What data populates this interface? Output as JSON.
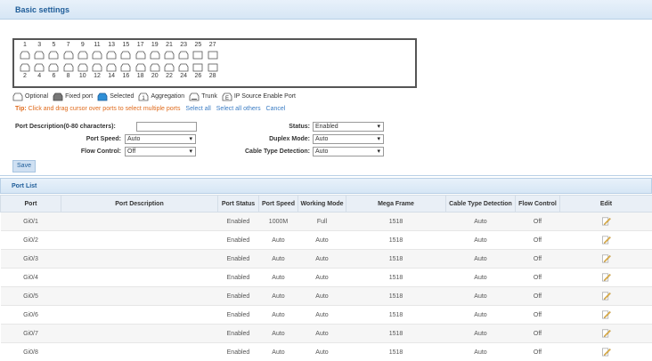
{
  "title": "Basic settings",
  "ports_top": [
    "1",
    "3",
    "5",
    "7",
    "9",
    "11",
    "13",
    "15",
    "17",
    "19",
    "21",
    "23",
    "25",
    "27"
  ],
  "ports_bottom": [
    "2",
    "4",
    "6",
    "8",
    "10",
    "12",
    "14",
    "16",
    "18",
    "20",
    "22",
    "24",
    "26",
    "28"
  ],
  "legend": {
    "optional": "Optional",
    "fixed": "Fixed port",
    "selected": "Selected",
    "aggregation": "Aggregation",
    "trunk": "Trunk",
    "ipsource": "IP Source Enable Port"
  },
  "tip": {
    "label": "Tip:",
    "text": "Click and drag cursor over ports to select multiple ports",
    "select_all": "Select all",
    "select_others": "Select all others",
    "cancel": "Cancel"
  },
  "form": {
    "desc_label": "Port Description(0-80 characters):",
    "desc_value": "",
    "status_label": "Status:",
    "status_value": "Enabled",
    "speed_label": "Port Speed:",
    "speed_value": "Auto",
    "duplex_label": "Duplex Mode:",
    "duplex_value": "Auto",
    "flow_label": "Flow Control:",
    "flow_value": "Off",
    "cable_label": "Cable Type Detection:",
    "cable_value": "Auto"
  },
  "save_label": "Save",
  "port_list": {
    "title": "Port List",
    "headers": [
      "Port",
      "Port Description",
      "Port Status",
      "Port Speed",
      "Working Mode",
      "Mega Frame",
      "Cable Type Detection",
      "Flow Control",
      "Edit"
    ],
    "rows": [
      [
        "Gi0/1",
        "",
        "Enabled",
        "1000M",
        "Full",
        "1518",
        "Auto",
        "Off"
      ],
      [
        "Gi0/2",
        "",
        "Enabled",
        "Auto",
        "Auto",
        "1518",
        "Auto",
        "Off"
      ],
      [
        "Gi0/3",
        "",
        "Enabled",
        "Auto",
        "Auto",
        "1518",
        "Auto",
        "Off"
      ],
      [
        "Gi0/4",
        "",
        "Enabled",
        "Auto",
        "Auto",
        "1518",
        "Auto",
        "Off"
      ],
      [
        "Gi0/5",
        "",
        "Enabled",
        "Auto",
        "Auto",
        "1518",
        "Auto",
        "Off"
      ],
      [
        "Gi0/6",
        "",
        "Enabled",
        "Auto",
        "Auto",
        "1518",
        "Auto",
        "Off"
      ],
      [
        "Gi0/7",
        "",
        "Enabled",
        "Auto",
        "Auto",
        "1518",
        "Auto",
        "Off"
      ],
      [
        "Gi0/8",
        "",
        "Enabled",
        "Auto",
        "Auto",
        "1518",
        "Auto",
        "Off"
      ]
    ]
  },
  "colors": {
    "accent": "#1f5d99",
    "tip": "#e06b1c",
    "link": "#3a7cc4",
    "selected_port": "#2f8fd6"
  }
}
